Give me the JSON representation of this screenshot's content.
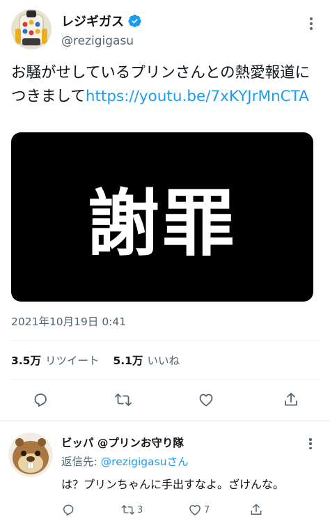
{
  "tweet": {
    "display_name": "レジギガス",
    "handle": "@rezigigasu",
    "text": "お騒がせしているプリンさんとの熱愛報道につきまして",
    "link": "https://youtu.be/7xKYJrMnCTA",
    "media_text": "謝罪",
    "timestamp": "2021年10月19日 0:41",
    "retweets_count": "3.5万",
    "retweets_label": "リツイート",
    "likes_count": "5.1万",
    "likes_label": "いいね",
    "colors": {
      "link": "#1d9bf0",
      "verified": "#1d9bf0",
      "secondary_text": "#536471"
    },
    "icons": [
      "verified-badge-icon",
      "more-icon",
      "reply-icon",
      "retweet-icon",
      "like-icon",
      "share-icon"
    ]
  },
  "reply": {
    "display_name": "ビッパ @プリンお守り隊",
    "replying_prefix": "返信先: ",
    "replying_mention": "@rezigigasu",
    "replying_suffix": "さん",
    "text": "は？プリンちゃんに手出すなよ。ざけんな。",
    "retweet_count": "3",
    "like_count": "7"
  }
}
